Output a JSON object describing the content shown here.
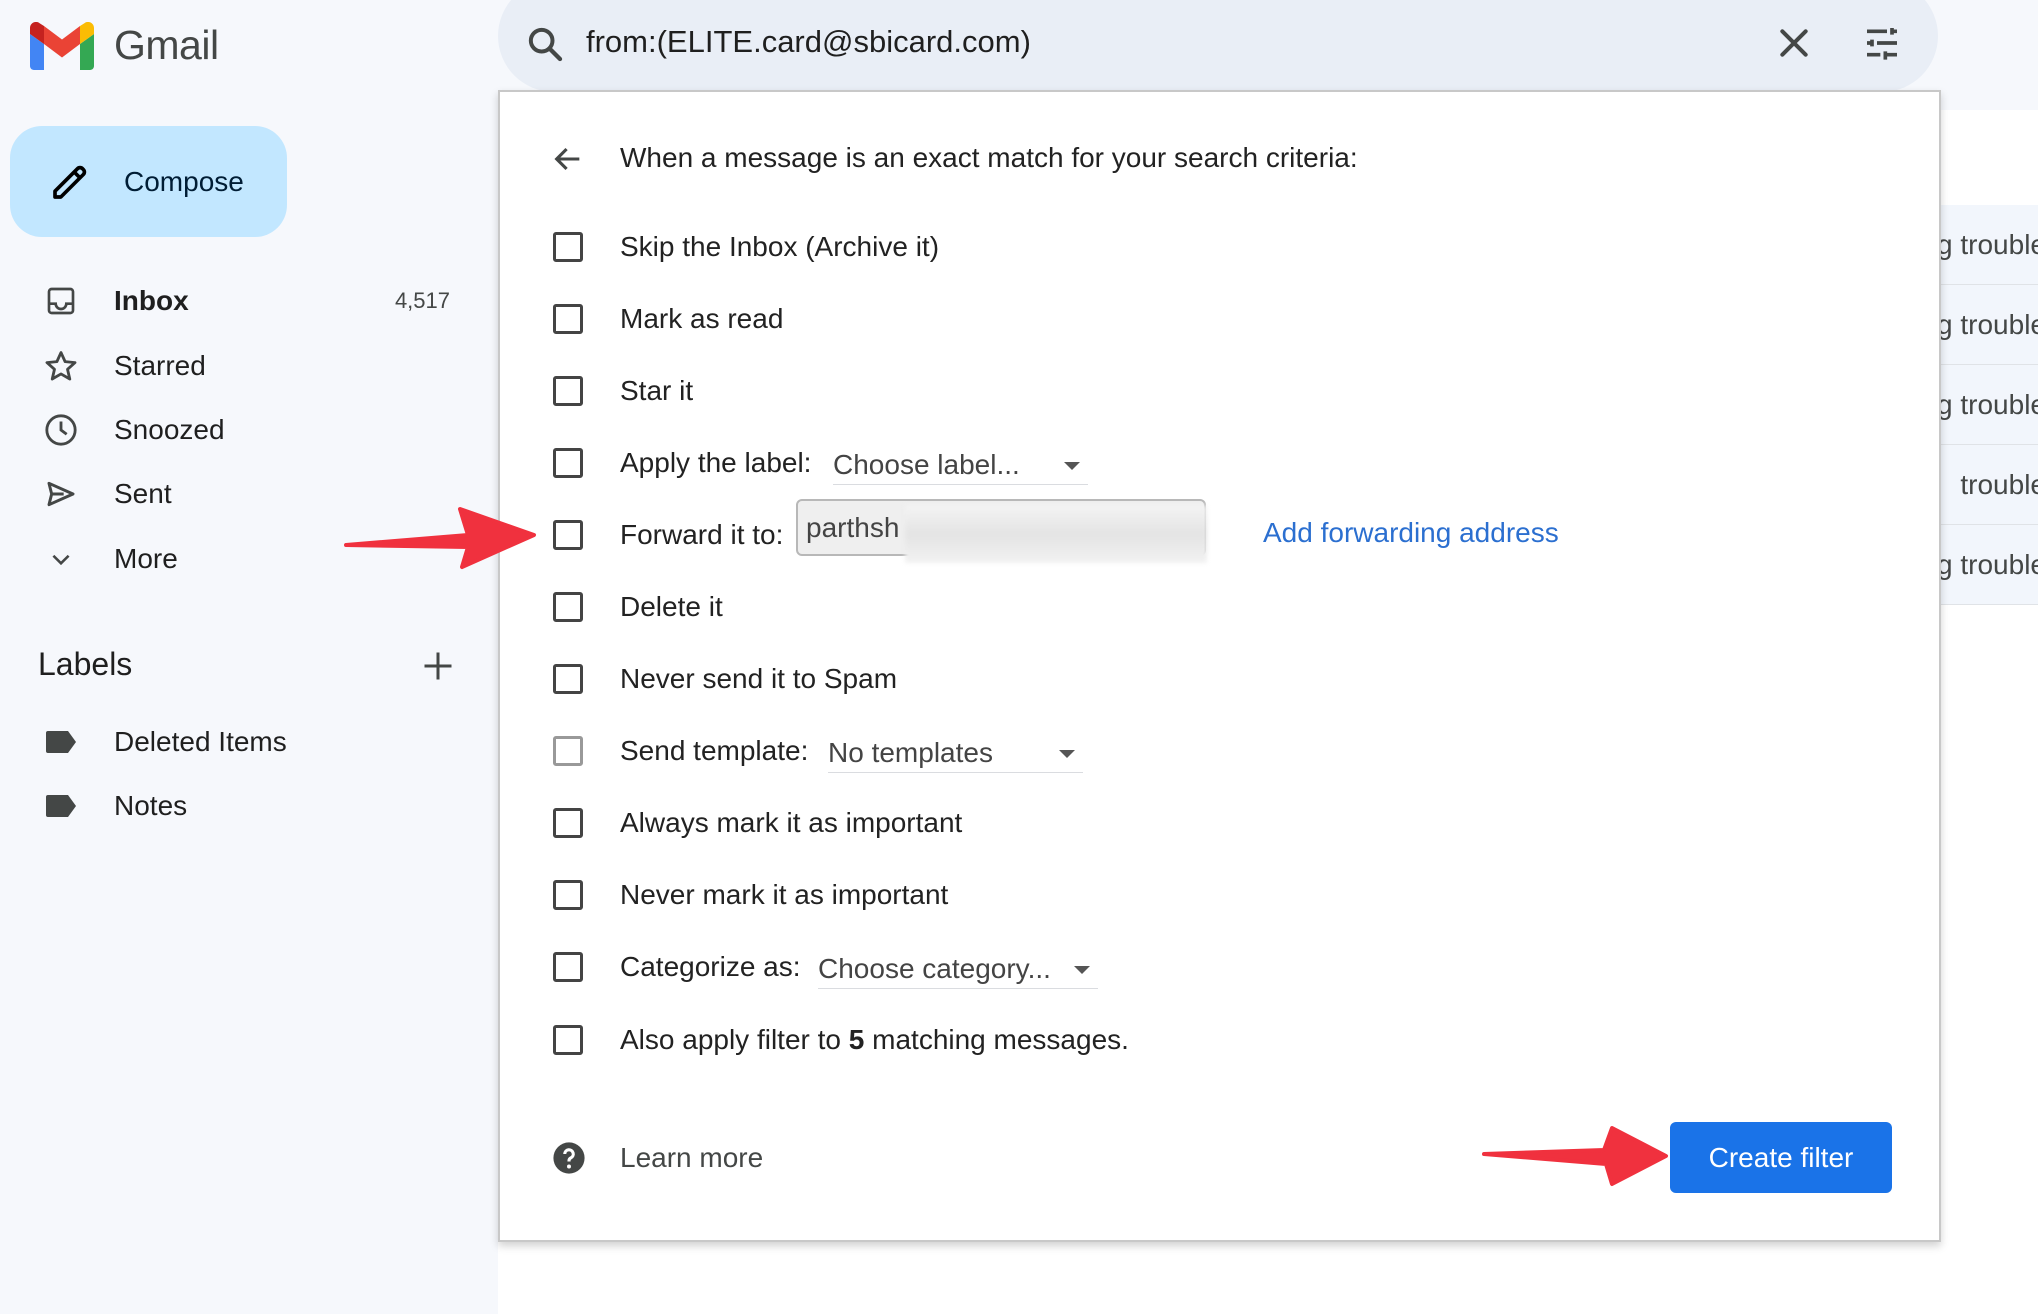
{
  "app": {
    "name": "Gmail",
    "brand_colors": {
      "red": "#ea4335",
      "blue": "#4285f4",
      "green": "#34a853",
      "yellow": "#fbbc04"
    }
  },
  "sidebar": {
    "compose_label": "Compose",
    "nav": [
      {
        "label": "Inbox",
        "icon": "inbox-icon",
        "count": "4,517",
        "bold": true
      },
      {
        "label": "Starred",
        "icon": "star-icon"
      },
      {
        "label": "Snoozed",
        "icon": "clock-icon"
      },
      {
        "label": "Sent",
        "icon": "send-icon"
      },
      {
        "label": "More",
        "icon": "chevron-down-icon"
      }
    ],
    "labels_title": "Labels",
    "labels": [
      {
        "label": "Deleted Items",
        "icon": "label-icon"
      },
      {
        "label": "Notes",
        "icon": "label-icon"
      }
    ]
  },
  "search": {
    "query": "from:(ELITE.card@sbicard.com)",
    "icons": [
      "search-icon",
      "clear-icon",
      "search-options-icon"
    ]
  },
  "filter_panel": {
    "header": "When a message is an exact match for your search criteria:",
    "options": [
      {
        "label": "Skip the Inbox (Archive it)",
        "checked": false
      },
      {
        "label": "Mark as read",
        "checked": false
      },
      {
        "label": "Star it",
        "checked": false
      },
      {
        "label": "Apply the label:",
        "checked": false,
        "dropdown": "Choose label..."
      },
      {
        "label": "Forward it to:",
        "checked": false,
        "select_value": "parthsh",
        "link": "Add forwarding address"
      },
      {
        "label": "Delete it",
        "checked": false
      },
      {
        "label": "Never send it to Spam",
        "checked": false
      },
      {
        "label": "Send template:",
        "checked": false,
        "disabled": true,
        "dropdown": "No templates"
      },
      {
        "label": "Always mark it as important",
        "checked": false
      },
      {
        "label": "Never mark it as important",
        "checked": false
      },
      {
        "label": "Categorize as:",
        "checked": false,
        "dropdown": "Choose category..."
      },
      {
        "label_prefix": "Also apply filter to ",
        "label_count": "5",
        "label_suffix": " matching messages.",
        "checked": false
      }
    ],
    "learn_more": "Learn more",
    "create_button": "Create filter",
    "primary_color": "#1a73e8"
  },
  "background_list": {
    "rows": [
      "g trouble",
      "g trouble",
      "g trouble",
      "trouble",
      "g trouble"
    ]
  },
  "annotations": {
    "arrow_color": "#f0313e",
    "arrows": [
      "arrow-to-forward-option",
      "arrow-to-create-filter"
    ]
  }
}
